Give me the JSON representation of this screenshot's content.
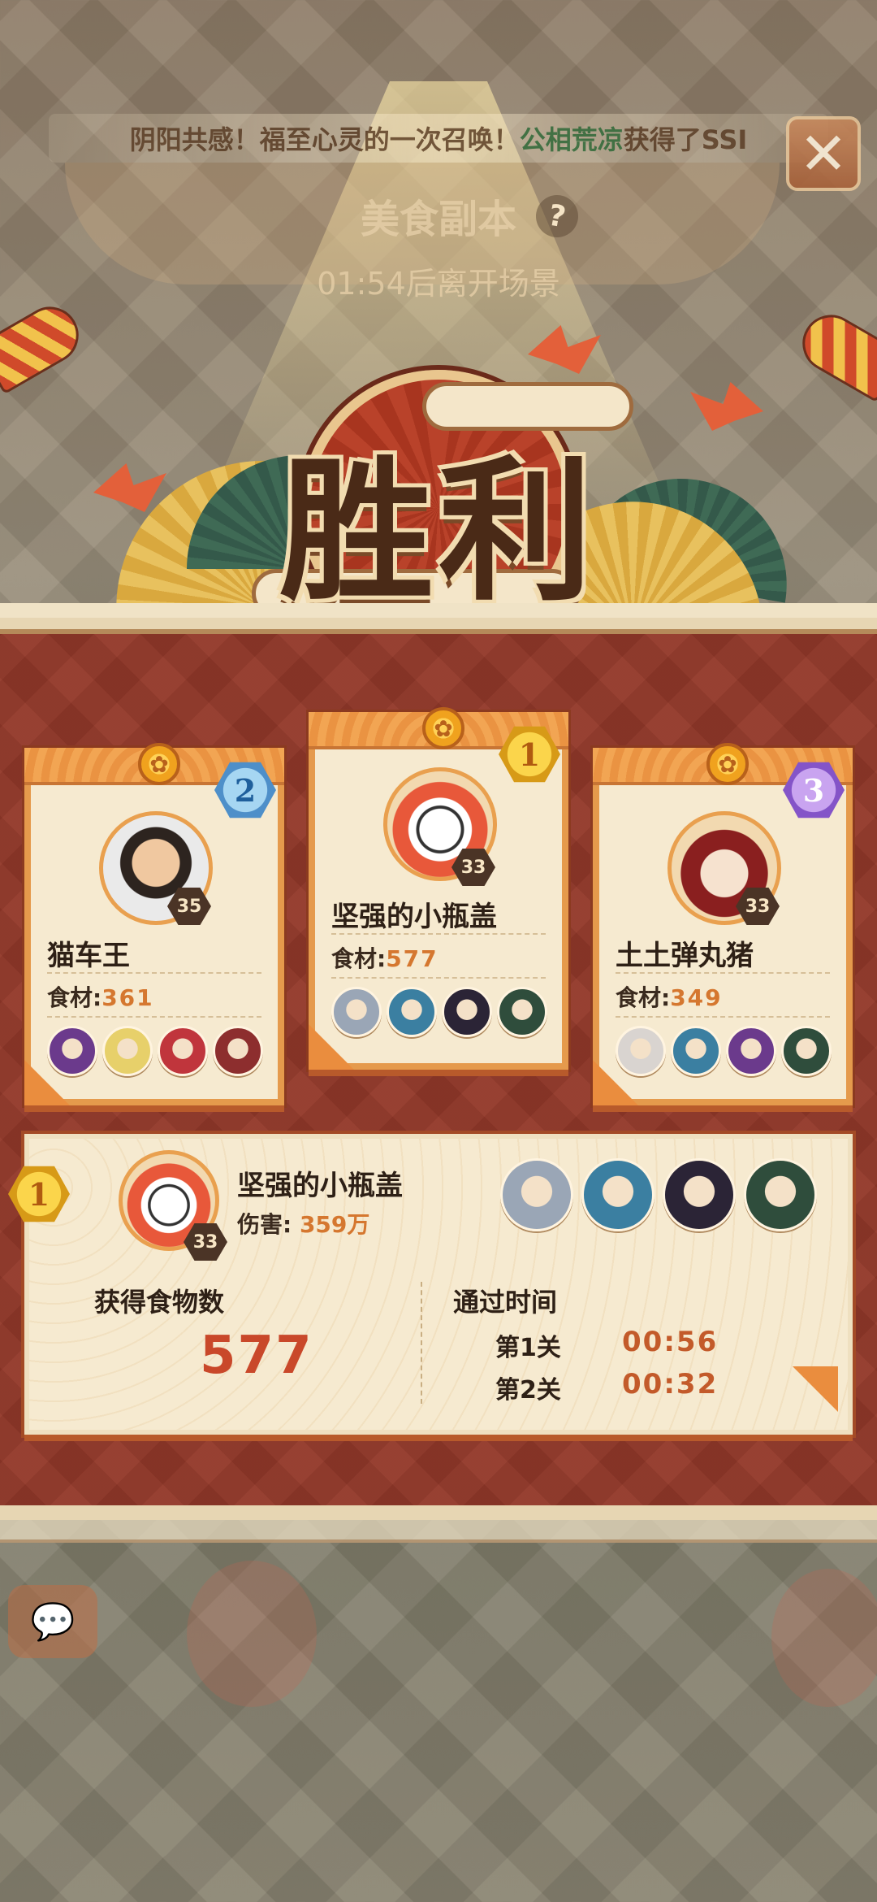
{
  "announcement": {
    "prefix": "阴阳共感！福至心灵的一次召唤！",
    "player": "公相荒凉",
    "suffix": "获得了SSI"
  },
  "dungeon": {
    "title": "美食副本",
    "help_icon": "?",
    "leave_timer": "01:54后离开场景"
  },
  "victory": {
    "title": "胜利"
  },
  "close_icon": "✕",
  "players": [
    {
      "rank": "2",
      "name": "猫车王",
      "food_label": "食材:",
      "food_value": "361",
      "level": "35",
      "shikigami": [
        "s1",
        "s2",
        "s3",
        "s4"
      ]
    },
    {
      "rank": "1",
      "name": "坚强的小瓶盖",
      "food_label": "食材:",
      "food_value": "577",
      "level": "33",
      "shikigami": [
        "s5",
        "s6",
        "s7",
        "s8"
      ]
    },
    {
      "rank": "3",
      "name": "土土弹丸猪",
      "food_label": "食材:",
      "food_value": "349",
      "level": "33",
      "shikigami": [
        "s9",
        "s6",
        "s1",
        "s8"
      ]
    }
  ],
  "mvp": {
    "rank": "1",
    "name": "坚强的小瓶盖",
    "level": "33",
    "damage_label": "伤害:",
    "damage_value": "359万"
  },
  "summary": {
    "food_label": "获得食物数",
    "food_total": "577",
    "time_label": "通过时间",
    "stages": [
      {
        "label": "第1关",
        "time": "00:56"
      },
      {
        "label": "第2关",
        "time": "00:32"
      }
    ]
  },
  "chat_icon": "💬",
  "colors": {
    "panel_red": "#93392a",
    "card_bg": "#f6ead0",
    "accent_orange": "#e59a4c",
    "value_orange": "#d5772f",
    "big_number_red": "#c9482a"
  },
  "icons": [
    "close-icon",
    "question-icon",
    "coin-icon",
    "rank-badge",
    "chat-icon"
  ]
}
